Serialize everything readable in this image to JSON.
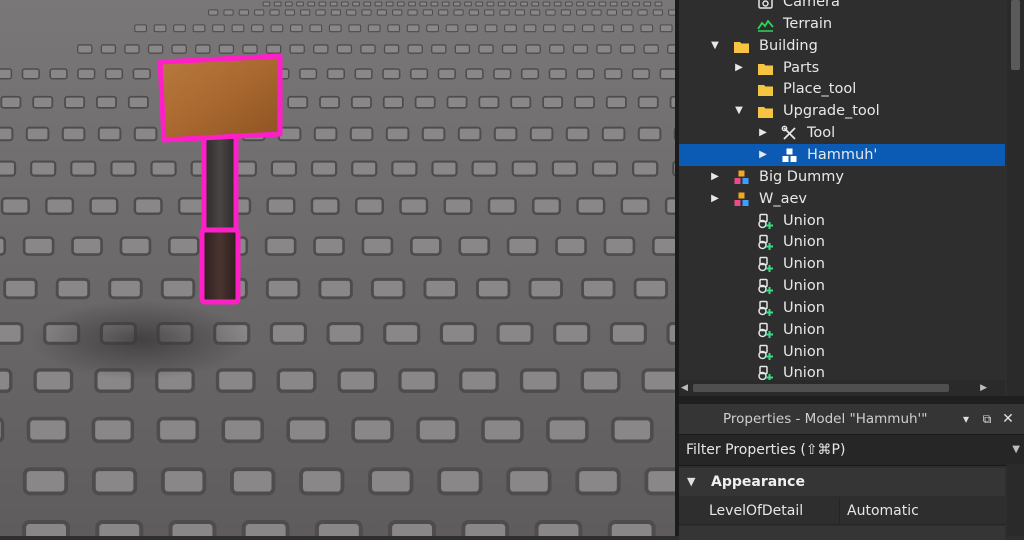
{
  "explorer": {
    "items": [
      {
        "label": "Camera",
        "icon": "camera-icon",
        "expanded": null,
        "selected": false
      },
      {
        "label": "Terrain",
        "icon": "terrain-icon",
        "expanded": null,
        "selected": false
      },
      {
        "label": "Building",
        "icon": "folder-icon",
        "expanded": true,
        "selected": false
      },
      {
        "label": "Parts",
        "icon": "folder-icon",
        "expanded": false,
        "selected": false
      },
      {
        "label": "Place_tool",
        "icon": "folder-icon",
        "expanded": null,
        "selected": false
      },
      {
        "label": "Upgrade_tool",
        "icon": "folder-icon",
        "expanded": true,
        "selected": false
      },
      {
        "label": "Tool",
        "icon": "tool-icon",
        "expanded": false,
        "selected": false
      },
      {
        "label": "Hammuh'",
        "icon": "model-icon",
        "expanded": false,
        "selected": true
      },
      {
        "label": "Big Dummy",
        "icon": "colored-model-icon",
        "expanded": false,
        "selected": false
      },
      {
        "label": "W_aev",
        "icon": "colored-model-icon",
        "expanded": false,
        "selected": false
      },
      {
        "label": "Union",
        "icon": "union-icon",
        "expanded": null,
        "selected": false
      },
      {
        "label": "Union",
        "icon": "union-icon",
        "expanded": null,
        "selected": false
      },
      {
        "label": "Union",
        "icon": "union-icon",
        "expanded": null,
        "selected": false
      },
      {
        "label": "Union",
        "icon": "union-icon",
        "expanded": null,
        "selected": false
      },
      {
        "label": "Union",
        "icon": "union-icon",
        "expanded": null,
        "selected": false
      },
      {
        "label": "Union",
        "icon": "union-icon",
        "expanded": null,
        "selected": false
      },
      {
        "label": "Union",
        "icon": "union-icon",
        "expanded": null,
        "selected": false
      },
      {
        "label": "Union",
        "icon": "union-icon",
        "expanded": null,
        "selected": false
      }
    ]
  },
  "properties": {
    "title": "Properties - Model \"Hammuh'\"",
    "filter_placeholder": "Filter Properties (⇧⌘P)",
    "category": "Appearance",
    "rows": [
      {
        "name": "LevelOfDetail",
        "value": "Automatic"
      }
    ]
  },
  "colors": {
    "selection": "#0b5bb5",
    "selection_outline": "#ff1fc6",
    "folder": "#f5c542",
    "terrain": "#2fd35a",
    "union_accent": "#3ddc84"
  }
}
